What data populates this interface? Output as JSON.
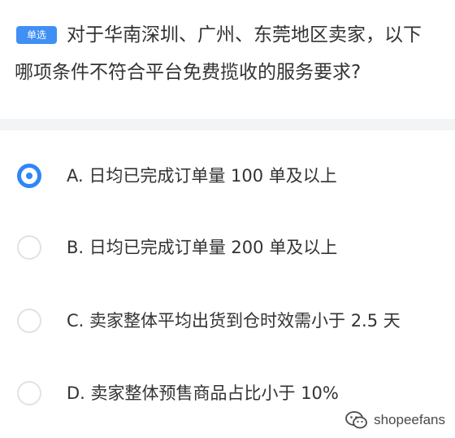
{
  "question": {
    "type_badge": "单选",
    "line1": "对于华南深圳、广州、东莞地区卖家，以下",
    "line2": "哪项条件不符合平台免费揽收的服务要求?"
  },
  "options": [
    {
      "label": "A. 日均已完成订单量 100 单及以上",
      "selected": true
    },
    {
      "label": "B. 日均已完成订单量 200 单及以上",
      "selected": false
    },
    {
      "label": "C. 卖家整体平均出货到仓时效需小于 2.5 天",
      "selected": false
    },
    {
      "label": "D. 卖家整体预售商品占比小于 10%",
      "selected": false
    }
  ],
  "watermark": {
    "text": "shopeefans",
    "icon": "wechat-icon"
  },
  "colors": {
    "accent": "#2f86f6",
    "badge": "#3f8ff5",
    "divider": "#f3f4f6",
    "text": "#333333"
  }
}
